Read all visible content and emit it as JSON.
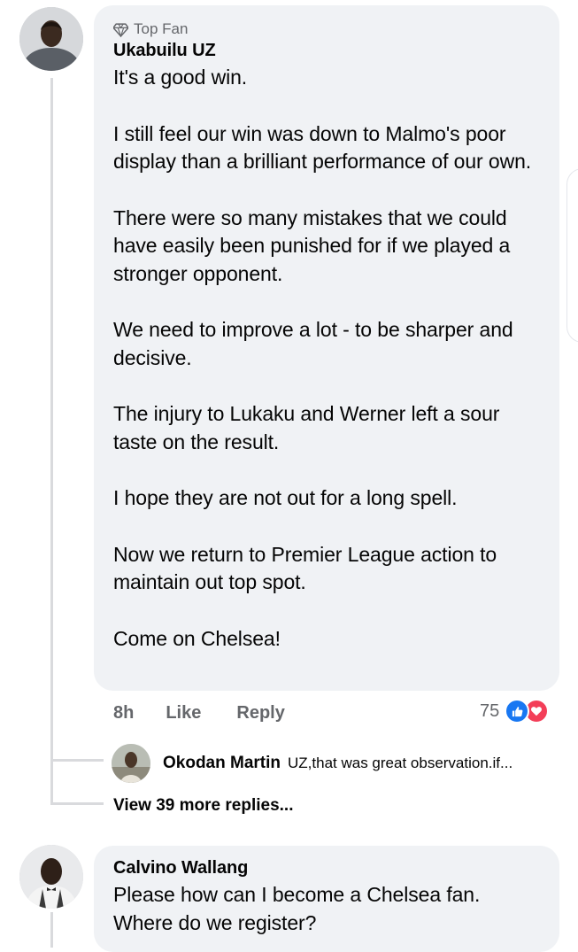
{
  "comment": {
    "badge": "Top Fan",
    "author": "Ukabuilu UZ",
    "paragraphs": [
      "It's a good win.",
      "I still feel our win was down to Malmo's poor display than a brilliant performance of our own.",
      "There were so many mistakes that we could have easily been punished for if we played a stronger opponent.",
      "We need to improve a lot - to be sharper and decisive.",
      "The injury to Lukaku and Werner left a sour taste on the result.",
      "I hope they are not out for a long spell.",
      "Now we return to Premier League action to maintain out top spot.",
      "Come on Chelsea!"
    ],
    "time": "8h",
    "like_label": "Like",
    "reply_label": "Reply",
    "reaction_count": "75",
    "reactions": [
      "like-icon",
      "love-icon"
    ]
  },
  "reply_preview": {
    "author": "Okodan Martin",
    "text": "UZ,that was great observation.if..."
  },
  "view_more": "View 39 more replies...",
  "second_comment": {
    "author": "Calvino Wallang",
    "paragraphs": [
      "Please how can I become a Chelsea fan. Where do we register?"
    ]
  },
  "colors": {
    "bubble": "#f0f2f5",
    "secondary_text": "#65676b",
    "like_blue": "#1877f2",
    "love_red": "#f33e58"
  }
}
